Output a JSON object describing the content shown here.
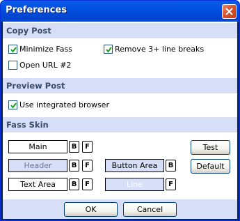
{
  "window": {
    "title": "Preferences"
  },
  "sections": {
    "copy_post": {
      "title": "Copy Post",
      "minimize": {
        "label": "Minimize Fass",
        "checked": true
      },
      "remove_breaks": {
        "label": "Remove 3+ line breaks",
        "checked": true
      },
      "open_url": {
        "label": "Open URL #2",
        "checked": false
      }
    },
    "preview_post": {
      "title": "Preview Post",
      "integrated": {
        "label": "Use integrated browser",
        "checked": true
      }
    },
    "fass_skin": {
      "title": "Fass Skin",
      "main": "Main",
      "header": "Header",
      "text_area": "Text Area",
      "button_area": "Button Area",
      "line": "Line",
      "b": "B",
      "f": "F",
      "test": "Test",
      "default": "Default"
    }
  },
  "footer": {
    "ok": "OK",
    "cancel": "Cancel"
  },
  "colors": {
    "title_bar": "#0050e0",
    "section_bg": "#d6dff7",
    "close": "#d8502a"
  }
}
